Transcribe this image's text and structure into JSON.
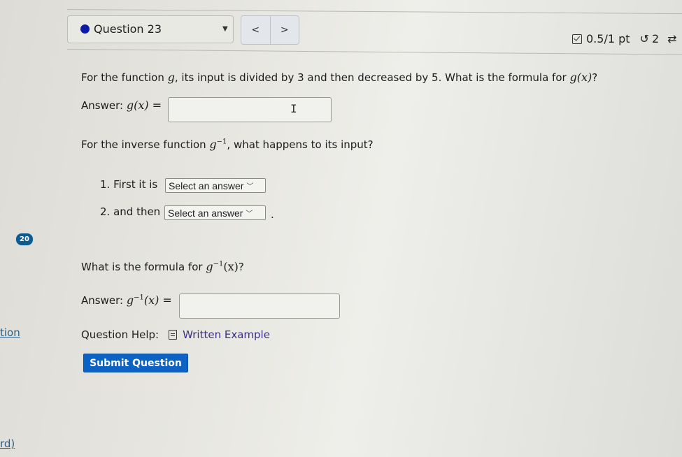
{
  "header": {
    "question_selector": "Question 23",
    "status_dot_color": "#0c1aa8",
    "prev_label": "<",
    "next_label": ">",
    "score": "0.5/1 pt",
    "attempts": "2",
    "icons": {
      "score": "checkbox-icon",
      "attempts": "retry-icon",
      "caret": "caret-down-icon"
    }
  },
  "part1": {
    "prompt_before": "For the function ",
    "prompt_var": "g",
    "prompt_after": ", its input is divided by 3 and then decreased by 5. What is the formula for ",
    "prompt_math": "g(x)",
    "prompt_end": "?",
    "answer_label": "Answer:",
    "answer_math": "g(x) =",
    "answer_value": ""
  },
  "part2": {
    "prompt_before": "For the inverse function ",
    "prompt_math": "g",
    "prompt_sup": "−1",
    "prompt_after": ", what happens to its input?",
    "steps": [
      {
        "label": "1. First it is",
        "select_value": "Select an answer",
        "suffix": ""
      },
      {
        "label": "2. and then",
        "select_value": "Select an answer",
        "suffix": "."
      }
    ]
  },
  "part3": {
    "prompt_before": "What is the formula for ",
    "prompt_math": "g",
    "prompt_sup": "−1",
    "prompt_arg": "(x)",
    "prompt_end": "?",
    "answer_label": "Answer:",
    "answer_math": "g",
    "answer_sup": "−1",
    "answer_arg": "(x) =",
    "answer_value": ""
  },
  "sidebar": {
    "badge": "20",
    "badge_color": "#0d5b8f",
    "link_fragment_1": "tion",
    "link_fragment_2": "rd)"
  },
  "help": {
    "label": "Question Help:",
    "link": "Written Example",
    "icon": "document-icon"
  },
  "submit": {
    "label": "Submit Question",
    "color": "#0c63c5"
  }
}
